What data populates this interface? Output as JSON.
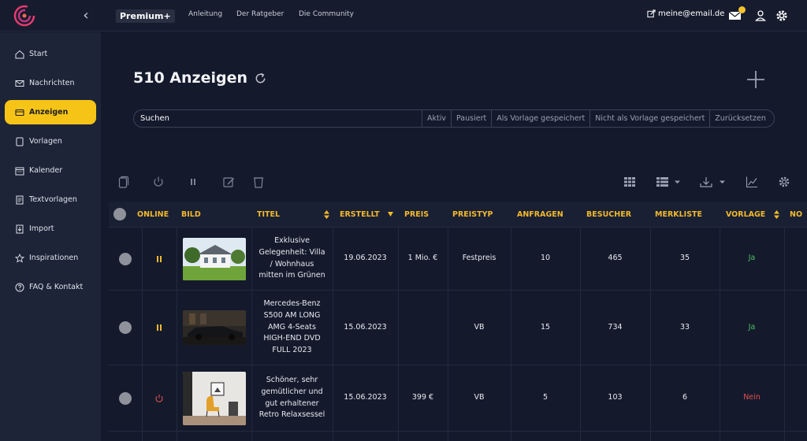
{
  "topbar": {
    "premium_label": "Premium+",
    "links": [
      "Anleitung",
      "Der Ratgeber",
      "Die Community"
    ],
    "email": "meine@email.de"
  },
  "sidebar": {
    "items": [
      {
        "label": "Start",
        "icon": "home-icon"
      },
      {
        "label": "Nachrichten",
        "icon": "mail-icon"
      },
      {
        "label": "Anzeigen",
        "icon": "ads-icon",
        "active": true
      },
      {
        "label": "Vorlagen",
        "icon": "template-icon"
      },
      {
        "label": "Kalender",
        "icon": "calendar-icon"
      },
      {
        "label": "Textvorlagen",
        "icon": "text-template-icon"
      },
      {
        "label": "Import",
        "icon": "import-icon"
      },
      {
        "label": "Inspirationen",
        "icon": "star-icon"
      },
      {
        "label": "FAQ & Kontakt",
        "icon": "help-icon"
      }
    ]
  },
  "main": {
    "title": "510 Anzeigen",
    "search": {
      "value": "Suchen"
    },
    "filters": [
      "Aktiv",
      "Pausiert",
      "Als Vorlage gespeichert",
      "Nicht als Vorlage gespeichert",
      "Zurücksetzen"
    ]
  },
  "table": {
    "columns": [
      "ONLINE",
      "BILD",
      "TITEL",
      "ERSTELLT",
      "PREIS",
      "PREISTYP",
      "ANFRAGEN",
      "BESUCHER",
      "MERKLISTE",
      "VORLAGE",
      "NO"
    ],
    "rows": [
      {
        "status": "paused",
        "title": "Exklusive Gelegenheit: Villa / Wohnhaus mitten im Grünen",
        "created": "19.06.2023",
        "price": "1 Mio. €",
        "price_type": "Festpreis",
        "requests": "10",
        "visitors": "465",
        "watchlist": "35",
        "template": "Ja"
      },
      {
        "status": "paused",
        "title": "Mercedes-Benz S500 AM LONG AMG 4-Seats HIGH-END DVD FULL 2023",
        "created": "15.06.2023",
        "price": "",
        "price_type": "VB",
        "requests": "15",
        "visitors": "734",
        "watchlist": "33",
        "template": "Ja"
      },
      {
        "status": "offline",
        "title": "Schöner, sehr gemütlicher und gut erhaltener Retro Relaxsessel",
        "created": "15.06.2023",
        "price": "399 €",
        "price_type": "VB",
        "requests": "5",
        "visitors": "103",
        "watchlist": "6",
        "template": "Nein"
      }
    ]
  },
  "colors": {
    "accent": "#f6c416",
    "header_text": "#f0b92d",
    "yes": "#4fbf63",
    "no": "#e04f4f",
    "paused": "#f0b92d",
    "offline": "#e04f4f"
  }
}
